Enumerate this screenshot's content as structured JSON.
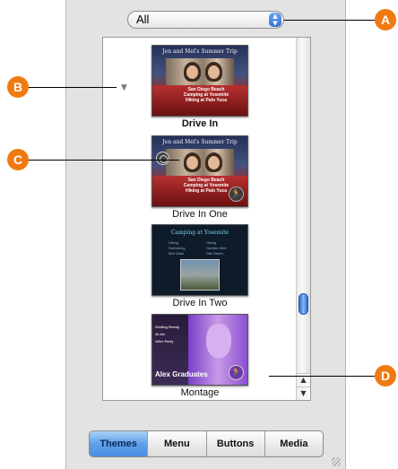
{
  "filter_popup": {
    "value": "All",
    "arrows": [
      "▲",
      "▼"
    ]
  },
  "themes": [
    {
      "caption": "Drive In",
      "thumb_title": "Jen and Mel's Summer Trip",
      "thumb_lines": [
        "San Diego Beach",
        "Camping at Yosemite",
        "Hiking at Palo Yuca"
      ]
    },
    {
      "caption": "Drive In One",
      "thumb_title": "Jen and Mel's Summer Trip",
      "thumb_lines": [
        "San Diego Beach",
        "Camping at Yosemite",
        "Hiking at Palo Yuca"
      ]
    },
    {
      "caption": "Drive In Two",
      "thumb_title": "Camping at Yosemite",
      "thumb_col_left": [
        "Hiking",
        "Swimming",
        "Bird Walk"
      ],
      "thumb_col_right": [
        "Hiking",
        "Garden Hike",
        "Nile Street"
      ]
    },
    {
      "caption": "Montage",
      "thumb_lines": [
        "Getting Ready",
        "At the",
        "After Party"
      ],
      "thumb_title": "Alex Graduates"
    }
  ],
  "scrollbar": {
    "up": "▲",
    "down": "▼"
  },
  "disclosure": "▼",
  "tabs": [
    {
      "label": "Themes"
    },
    {
      "label": "Menu"
    },
    {
      "label": "Buttons"
    },
    {
      "label": "Media"
    }
  ],
  "callouts": {
    "a": "A",
    "b": "B",
    "c": "C",
    "d": "D"
  },
  "colors": {
    "callout": "#f07a12",
    "tab_active": "#5ea0ea"
  }
}
